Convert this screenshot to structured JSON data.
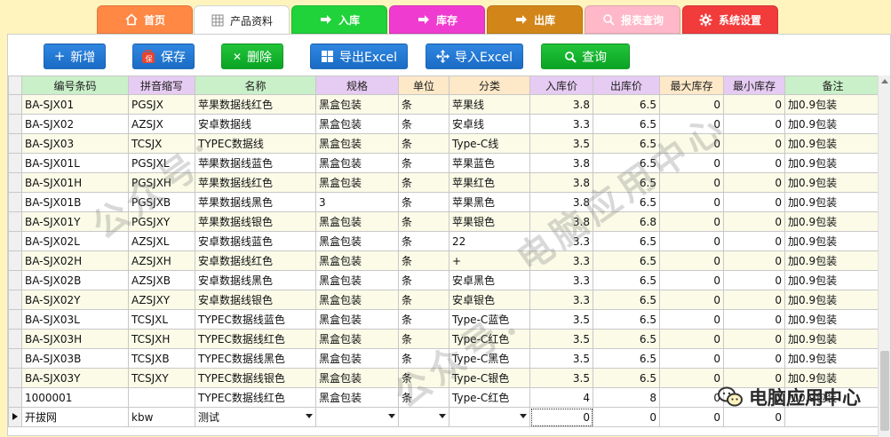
{
  "tabs": [
    {
      "label": "首页",
      "icon": "home-icon",
      "color": "#ff8040"
    },
    {
      "label": "产品资料",
      "icon": "grid-icon",
      "color": "#ffffff"
    },
    {
      "label": "入库",
      "icon": "arrow-in-icon",
      "color": "#2ec63f"
    },
    {
      "label": "库存",
      "icon": "arrow-right-icon",
      "color": "#f044c8"
    },
    {
      "label": "出库",
      "icon": "arrow-out-icon",
      "color": "#d88b1c"
    },
    {
      "label": "报表查询",
      "icon": "search-icon",
      "color": "#ffb3c6"
    },
    {
      "label": "系统设置",
      "icon": "gear-icon",
      "color": "#f13c3c"
    }
  ],
  "toolbar": {
    "add_label": "新增",
    "save_label": "保存",
    "delete_label": "删除",
    "export_label": "导出Excel",
    "import_label": "导入Excel",
    "query_label": "查询"
  },
  "columns": [
    "编号条码",
    "拼音缩写",
    "名称",
    "规格",
    "单位",
    "分类",
    "入库价",
    "出库价",
    "最大库存",
    "最小库存",
    "备注"
  ],
  "column_colors": [
    "#c9f0c9",
    "#e2c6ef",
    "#c9f0c9",
    "#e2c6ef",
    "#fde8c8",
    "#fde8c8",
    "#e2c6ef",
    "#e2c6ef",
    "#fde8c8",
    "#e2c6ef",
    "#c9f0c9"
  ],
  "rows": [
    [
      "BA-SJX01",
      "PGSJX",
      "苹果数据线红色",
      "黑盒包装",
      "条",
      "苹果线",
      "3.8",
      "6.5",
      "0",
      "0",
      "加0.9包装"
    ],
    [
      "BA-SJX02",
      "AZSJX",
      "安卓数据线",
      "黑盒包装",
      "条",
      "安卓线",
      "3.3",
      "6.5",
      "0",
      "0",
      "加0.9包装"
    ],
    [
      "BA-SJX03",
      "TCSJX",
      "TYPEC数据线",
      "黑盒包装",
      "条",
      "Type-C线",
      "3.5",
      "6.5",
      "0",
      "0",
      "加0.9包装"
    ],
    [
      "BA-SJX01L",
      "PGSJXL",
      "苹果数据线蓝色",
      "黑盒包装",
      "条",
      "苹果蓝色",
      "3.8",
      "6.5",
      "0",
      "0",
      "加0.9包装"
    ],
    [
      "BA-SJX01H",
      "PGSJXH",
      "苹果数据线红色",
      "黑盒包装",
      "条",
      "苹果红色",
      "3.8",
      "6.5",
      "0",
      "0",
      "加0.9包装"
    ],
    [
      "BA-SJX01B",
      "PGSJXB",
      "苹果数据线黑色",
      "3",
      "条",
      "苹果黑色",
      "3.8",
      "6.5",
      "0",
      "0",
      "加0.9包装"
    ],
    [
      "BA-SJX01Y",
      "PGSJXY",
      "苹果数据线银色",
      "黑盒包装",
      "条",
      "苹果银色",
      "3.8",
      "6.8",
      "0",
      "0",
      "加0.9包装"
    ],
    [
      "BA-SJX02L",
      "AZSJXL",
      "安卓数据线蓝色",
      "黑盒包装",
      "条",
      "22",
      "3.3",
      "6.5",
      "0",
      "0",
      "加0.9包装"
    ],
    [
      "BA-SJX02H",
      "AZSJXH",
      "安卓数据线红色",
      "黑盒包装",
      "条",
      "+",
      "3.3",
      "6.5",
      "0",
      "0",
      "加0.9包装"
    ],
    [
      "BA-SJX02B",
      "AZSJXB",
      "安卓数据线黑色",
      "黑盒包装",
      "条",
      "安卓黑色",
      "3.3",
      "6.5",
      "0",
      "0",
      "加0.9包装"
    ],
    [
      "BA-SJX02Y",
      "AZSJXY",
      "安卓数据线银色",
      "黑盒包装",
      "条",
      "安卓银色",
      "3.3",
      "6.5",
      "0",
      "0",
      "加0.9包装"
    ],
    [
      "BA-SJX03L",
      "TCSJXL",
      "TYPEC数据线蓝色",
      "黑盒包装",
      "条",
      "Type-C蓝色",
      "3.5",
      "6.5",
      "0",
      "0",
      "加0.9包装"
    ],
    [
      "BA-SJX03H",
      "TCSJXH",
      "TYPEC数据线红色",
      "黑盒包装",
      "条",
      "Type-C红色",
      "3.5",
      "6.5",
      "0",
      "0",
      "加0.9包装"
    ],
    [
      "BA-SJX03B",
      "TCSJXB",
      "TYPEC数据线黑色",
      "黑盒包装",
      "条",
      "Type-C黑色",
      "3.5",
      "6.5",
      "0",
      "0",
      "加0.9包装"
    ],
    [
      "BA-SJX03Y",
      "TCSJXY",
      "TYPEC数据线银色",
      "黑盒包装",
      "条",
      "Type-C银色",
      "3.5",
      "6.5",
      "0",
      "0",
      "加0.9包装"
    ],
    [
      "1000001",
      "",
      "TYPEC数据线红色",
      "黑盒包装",
      "条",
      "Type-C红色",
      "4",
      "8",
      "0",
      "0",
      "加0.9包装"
    ]
  ],
  "new_row": [
    "开拔网",
    "kbw",
    "测试",
    "",
    "",
    "",
    "0",
    "0",
    "0",
    "0",
    ""
  ],
  "watermark": {
    "left": "公众号：",
    "right": "电脑应用中心"
  },
  "brand": {
    "label": "电脑应用中心",
    "icon": "wechat-icon"
  }
}
